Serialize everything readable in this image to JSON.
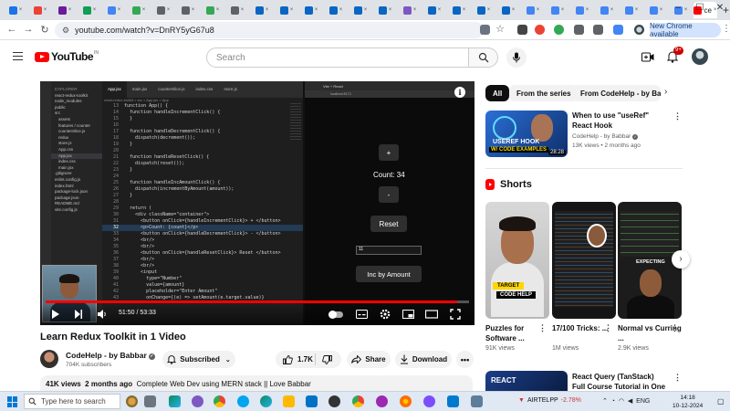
{
  "browser": {
    "active_tab_label": "ce",
    "tab_close": "×",
    "new_tab": "+",
    "url": "youtube.com/watch?v=DnRY5yG67u8",
    "update_button": "New Chrome available",
    "tab_favicons": [
      "#1a73e8",
      "#ea4335",
      "#6a1b9a",
      "#0f9d58",
      "#4285f4",
      "#34a853",
      "#5f6368",
      "#5f6368",
      "#34a853",
      "#5f6368",
      "#0a66c2",
      "#0a66c2",
      "#0a66c2",
      "#0a66c2",
      "#0a66c2",
      "#0a66c2",
      "#7e57c2",
      "#0a66c2",
      "#0a66c2",
      "#0a66c2",
      "#0a66c2",
      "#4285f4",
      "#4285f4",
      "#4285f4",
      "#4285f4",
      "#4285f4",
      "#4285f4",
      "#4285f4"
    ]
  },
  "youtube": {
    "logo_text": "YouTube",
    "logo_country": "IN",
    "search_placeholder": "Search",
    "notification_count": "9+"
  },
  "player": {
    "vscode": {
      "explorer_title": "EXPLORER",
      "explorer_items": [
        "react-redux-toolkit",
        "node_modules",
        "public",
        "src",
        "assets",
        "features / counter",
        "counterSlice.js",
        "redux",
        "store.js",
        "App.css",
        "App.jsx",
        "index.css",
        "main.jsx",
        ".gitignore",
        "eslint.config.js",
        "index.html",
        "package-lock.json",
        "package.json",
        "README.md",
        "vite.config.js"
      ],
      "tabs": [
        "App.jsx",
        "main.jsx",
        "counterSlice.js",
        "index.css",
        "store.js"
      ],
      "breadcrumb": "react-redux-toolkit > src > App.jsx > App",
      "code_lines": [
        {
          "n": "13",
          "t": "function App() {"
        },
        {
          "n": "14",
          "t": "  function handleIncrementClick() {"
        },
        {
          "n": "15",
          "t": "  }"
        },
        {
          "n": "16",
          "t": ""
        },
        {
          "n": "17",
          "t": "  function handleDecrementClick() {"
        },
        {
          "n": "18",
          "t": "    dispatch(decrement());"
        },
        {
          "n": "19",
          "t": "  }"
        },
        {
          "n": "20",
          "t": ""
        },
        {
          "n": "21",
          "t": "  function handleResetClick() {"
        },
        {
          "n": "22",
          "t": "    dispatch(reset());"
        },
        {
          "n": "23",
          "t": "  }"
        },
        {
          "n": "24",
          "t": ""
        },
        {
          "n": "25",
          "t": "  function handleIncAmountClick() {"
        },
        {
          "n": "26",
          "t": "    dispatch(incrementByAmount(amount));"
        },
        {
          "n": "27",
          "t": "  }"
        },
        {
          "n": "28",
          "t": ""
        },
        {
          "n": "29",
          "t": "  return ("
        },
        {
          "n": "30",
          "t": "    <div className=\"container\">"
        },
        {
          "n": "31",
          "t": "      <button onClick={handleIncrementClick}> + </button>"
        },
        {
          "n": "32",
          "t": "      <p>Count: {count}</p>"
        },
        {
          "n": "33",
          "t": "      <button onClick={handleDecrementClick}> - </button>"
        },
        {
          "n": "34",
          "t": "      <br/>"
        },
        {
          "n": "35",
          "t": "      <br/>"
        },
        {
          "n": "36",
          "t": "      <button onClick={handleResetClick}> Reset </button>"
        },
        {
          "n": "37",
          "t": "      <br/>"
        },
        {
          "n": "38",
          "t": "      <br/>"
        },
        {
          "n": "39",
          "t": "      <input"
        },
        {
          "n": "40",
          "t": "        type=\"Number\""
        },
        {
          "n": "41",
          "t": "        value={amount}"
        },
        {
          "n": "42",
          "t": "        placeholder=\"Enter Amount\""
        },
        {
          "n": "43",
          "t": "        onChange={(e) => setAmount(e.target.value)}"
        }
      ]
    },
    "app": {
      "tab_title": "Vite + React",
      "url": "localhost:5173",
      "plus_label": "+",
      "count_label": "Count: 34",
      "minus_label": "-",
      "reset_label": "Reset",
      "amount_value": "11",
      "inc_amount_label": "Inc by Amount"
    },
    "progress_fraction": 0.971,
    "time_current": "51:50",
    "time_separator": " / ",
    "time_total": "53:33"
  },
  "video": {
    "title": "Learn Redux Toolkit in 1 Video",
    "channel_name": "CodeHelp - by Babbar",
    "subscribers": "704K subscribers",
    "subscribe_label": "Subscribed",
    "likes": "1.7K",
    "share_label": "Share",
    "download_label": "Download",
    "views": "41K views",
    "uploaded": "2 months ago",
    "description": "Complete Web Dev using MERN stack || Love Babbar"
  },
  "sidebar": {
    "chips": [
      "All",
      "From the series",
      "From CodeHelp - by Babbar"
    ],
    "rec1": {
      "thumb_text1": "USEREF HOOK",
      "thumb_text2": "W/ CODE EXAMPLES",
      "duration": "28:28",
      "title": "When to use \"useRef\" React Hook",
      "channel": "CodeHelp - by Babbar",
      "meta": "13K views • 2 months ago"
    },
    "shorts_title": "Shorts",
    "shorts": [
      {
        "title": "Puzzles for Software ...",
        "views": "91K views",
        "cap1": "TARGET",
        "cap2": "CODE HELP"
      },
      {
        "title": "17/100 Tricks: ...",
        "views": "1M views"
      },
      {
        "title": "Normal vs Curring ...",
        "views": "2.9K views",
        "label": "EXPECTING"
      }
    ],
    "rec2": {
      "thumb_text": "REACT",
      "title": "React Query (TanStack) Full Course Tutorial in One Video"
    }
  },
  "taskbar": {
    "search_placeholder": "Type here to search",
    "stock_name": "AIRTELPP",
    "stock_change": "-2.78%",
    "language": "ENG",
    "time": "14:18",
    "date": "10-12-2024"
  }
}
